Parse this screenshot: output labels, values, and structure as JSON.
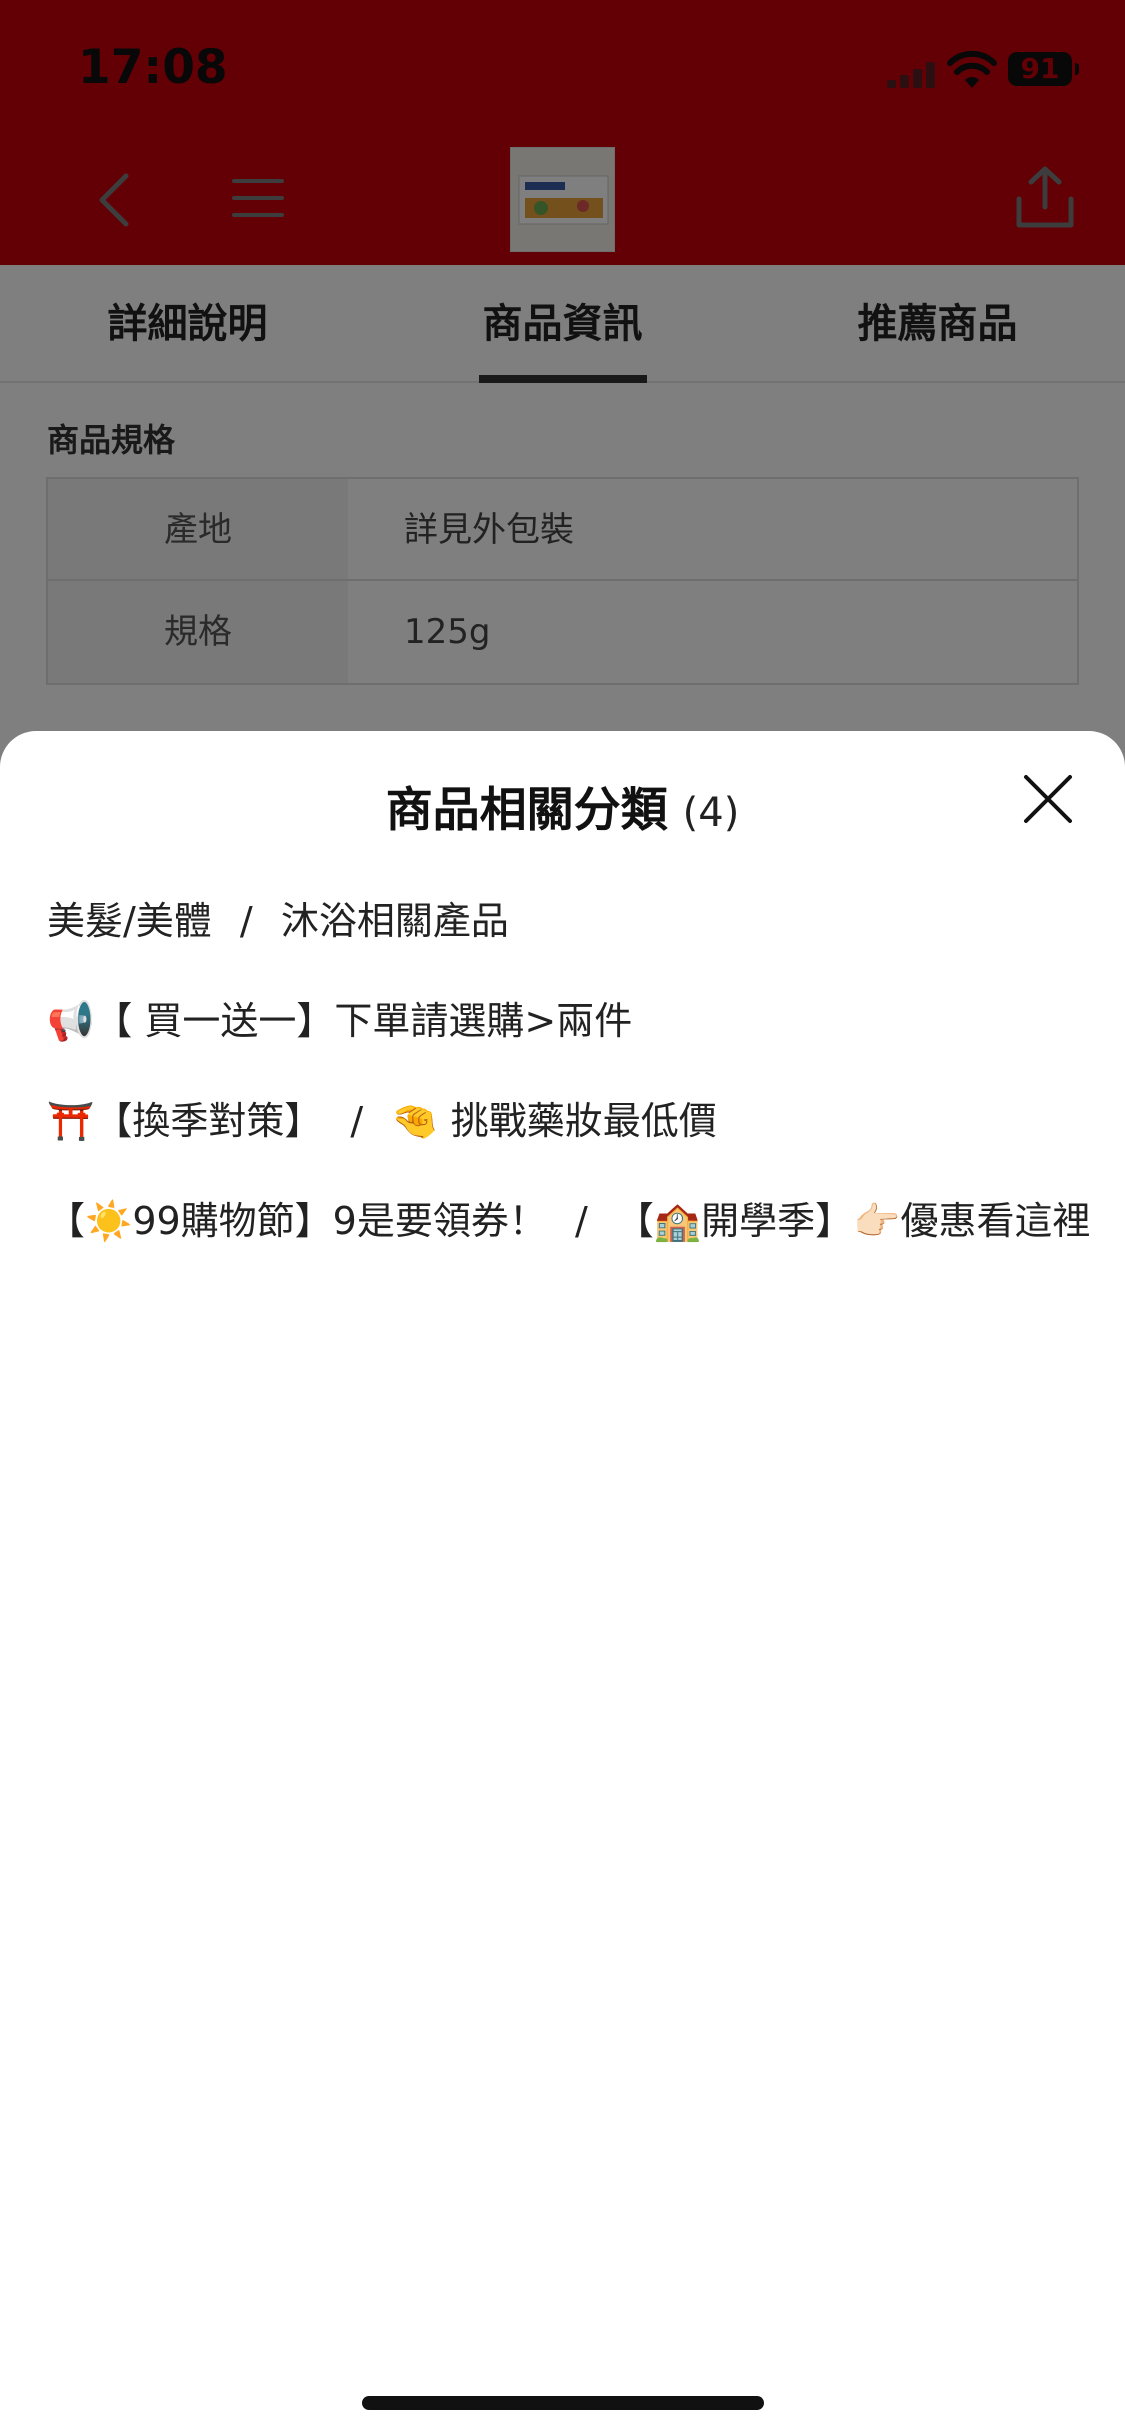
{
  "status_bar": {
    "time": "17:08",
    "battery": "91"
  },
  "tabs": [
    {
      "label": "詳細說明",
      "active": false
    },
    {
      "label": "商品資訊",
      "active": true
    },
    {
      "label": "推薦商品",
      "active": false
    }
  ],
  "spec": {
    "title": "商品規格",
    "rows": [
      {
        "key": "產地",
        "value": "詳見外包裝"
      },
      {
        "key": "規格",
        "value": "125g"
      }
    ]
  },
  "sheet": {
    "title": "商品相關分類",
    "count": "(4)",
    "lines": [
      [
        "美髮/美體",
        "沐浴相關產品"
      ],
      [
        "📢【 買一送一】下單請選購>兩件"
      ],
      [
        "⛩️【換季對策】",
        "🤏 挑戰藥妝最低價"
      ],
      [
        "【☀️99購物節】9是要領券！",
        "【🏫開學季】👉🏻優惠看這裡"
      ]
    ],
    "separator": "/"
  },
  "colors": {
    "brand_red": "#c5000b"
  }
}
